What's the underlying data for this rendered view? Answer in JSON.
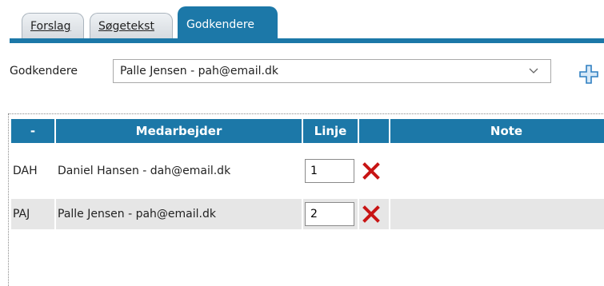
{
  "tabs": [
    {
      "label": "Forslag"
    },
    {
      "label": "Søgetekst"
    },
    {
      "label": "Godkendere"
    }
  ],
  "approver": {
    "label": "Godkendere",
    "selected": "Palle Jensen - pah@email.dk"
  },
  "icons": {
    "add": "plus-icon",
    "dropdown": "chevron-down-icon",
    "delete": "close-icon"
  },
  "colors": {
    "accent": "#1c78a8",
    "delete": "#c81414",
    "row_alt": "#e6e6e6"
  },
  "table": {
    "headers": [
      "-",
      "Medarbejder",
      "Linje",
      "",
      "Note"
    ],
    "rows": [
      {
        "code": "DAH",
        "employee": "Daniel Hansen - dah@email.dk",
        "line": "1",
        "note": ""
      },
      {
        "code": "PAJ",
        "employee": "Palle Jensen - pah@email.dk",
        "line": "2",
        "note": ""
      }
    ]
  }
}
